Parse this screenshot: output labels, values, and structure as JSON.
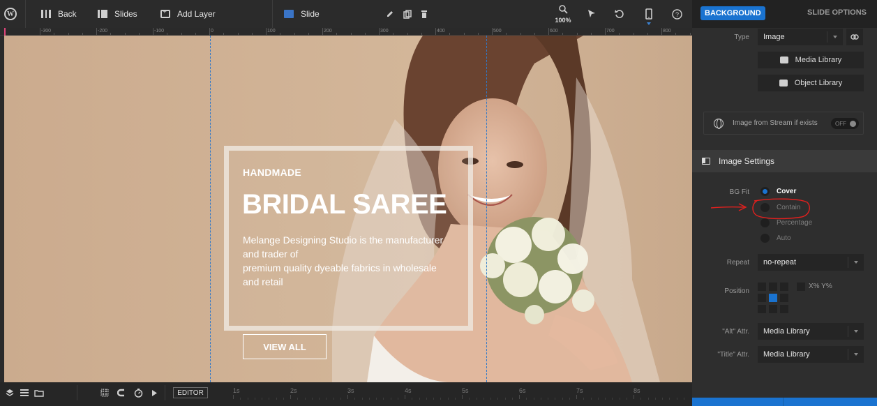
{
  "toolbar": {
    "back_label": "Back",
    "slides_label": "Slides",
    "add_layer_label": "Add Layer",
    "slide_label": "Slide",
    "zoom_level": "100%",
    "icons": [
      "wordpress-icon",
      "back-icon",
      "slides-icon",
      "add-layer-icon",
      "slide-icon",
      "edit-icon",
      "duplicate-icon",
      "delete-icon",
      "zoom-icon",
      "cursor-icon",
      "undo-icon",
      "mobile-device-icon",
      "help-icon"
    ]
  },
  "ruler": {
    "labels": [
      "-300",
      "-200",
      "-100",
      "0",
      "100",
      "200",
      "300",
      "400",
      "500",
      "600",
      "700",
      "800"
    ]
  },
  "slide": {
    "subtitle": "HANDMADE",
    "title": "BRIDAL SAREE",
    "description_lines": [
      "Melange Designing Studio is the manufacturer",
      "and trader of",
      "premium quality dyeable fabrics in wholesale",
      "and retail"
    ],
    "button_label": "VIEW ALL",
    "background_color": "#ccad90"
  },
  "timeline": {
    "editor_label": "EDITOR",
    "seconds": [
      "1s",
      "2s",
      "3s",
      "4s",
      "5s",
      "6s",
      "7s",
      "8s"
    ]
  },
  "panel": {
    "tabs": {
      "background": "BACKGROUND",
      "slide_options": "SLIDE OPTIONS"
    },
    "type_label": "Type",
    "type_value": "Image",
    "media_library_button": "Media Library",
    "object_library_button": "Object Library",
    "stream_label": "Image from Stream if exists",
    "stream_toggle": "OFF",
    "image_settings_title": "Image Settings",
    "bg_fit_label": "BG Fit",
    "bg_fit_options": [
      {
        "label": "Cover",
        "selected": true
      },
      {
        "label": "Contain",
        "selected": false
      },
      {
        "label": "Percentage",
        "selected": false
      },
      {
        "label": "Auto",
        "selected": false
      }
    ],
    "repeat_label": "Repeat",
    "repeat_value": "no-repeat",
    "position_label": "Position",
    "position_percent_label": "X% Y%",
    "alt_label": "\"Alt\" Attr.",
    "alt_value": "Media Library",
    "title_attr_label": "\"Title\" Attr.",
    "title_attr_value": "Media Library"
  },
  "colors": {
    "accent": "#1a73d0",
    "annotation": "#e0201e",
    "guide": "#2f79c9"
  }
}
